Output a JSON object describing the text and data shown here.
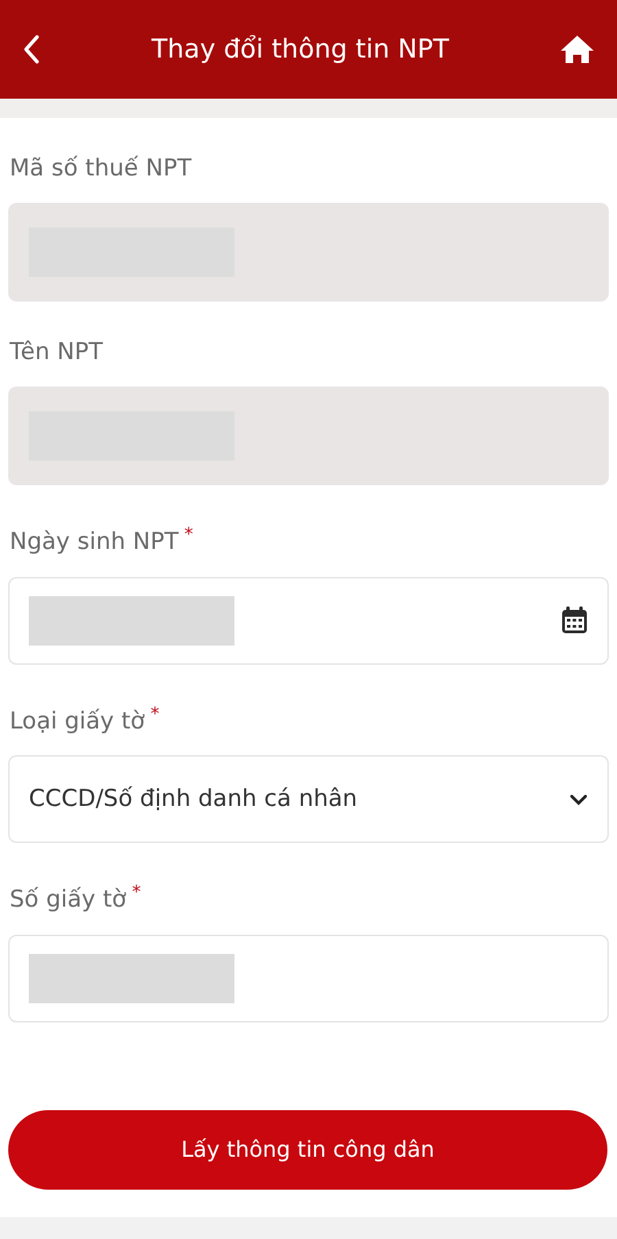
{
  "header": {
    "title": "Thay đổi thông tin NPT"
  },
  "fields": [
    {
      "label": "Mã số thuế NPT",
      "kind": "text",
      "required": false,
      "disabled": true,
      "redacted": true
    },
    {
      "label": "Tên NPT",
      "kind": "text",
      "required": false,
      "disabled": true,
      "redacted": true
    },
    {
      "label": "Ngày sinh NPT",
      "kind": "date",
      "required": true,
      "required_mark": "*",
      "disabled": false,
      "redacted": true
    },
    {
      "label": "Loại giấy tờ",
      "kind": "select",
      "required": true,
      "required_mark": "*",
      "disabled": false,
      "value": "CCCD/Số định danh cá nhân"
    },
    {
      "label": "Số giấy tờ",
      "kind": "text",
      "required": true,
      "required_mark": "*",
      "disabled": false,
      "redacted": true
    }
  ],
  "submit_button": "Lấy thông tin công dân"
}
